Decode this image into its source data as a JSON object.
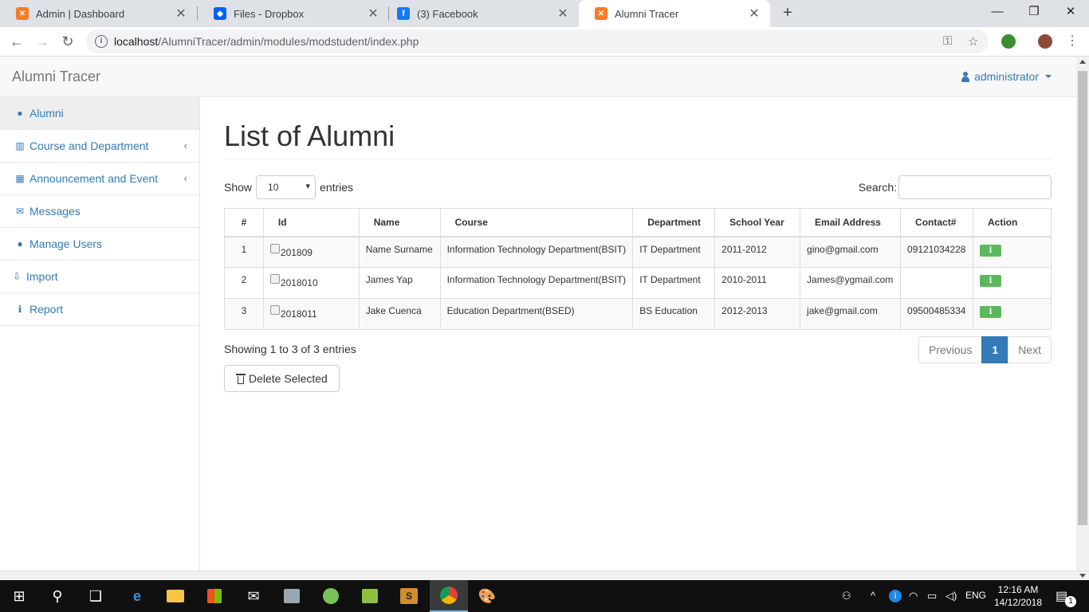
{
  "browser": {
    "tabs": [
      {
        "title": "Admin | Dashboard",
        "favicon": "xampp-icon",
        "favicon_color": "#fb7a24"
      },
      {
        "title": "Files - Dropbox",
        "favicon": "dropbox-icon",
        "favicon_color": "#0061fe"
      },
      {
        "title": "(3) Facebook",
        "favicon": "facebook-icon",
        "favicon_color": "#1877f2"
      },
      {
        "title": "Alumni Tracer",
        "favicon": "xampp-icon",
        "favicon_color": "#fb7a24"
      }
    ],
    "active_tab": 3,
    "close_glyph": "✕",
    "new_tab_glyph": "+",
    "url_host": "localhost",
    "url_path": "/AlumniTracer/admin/modules/modstudent/index.php"
  },
  "app": {
    "brand": "Alumni Tracer",
    "user": "administrator",
    "colors": {
      "link": "#337ab7",
      "success": "#5cb85c"
    },
    "sidebar": [
      {
        "label": "Alumni",
        "icon": "user-icon",
        "glyph": "👤",
        "active": true,
        "has_arrow": false
      },
      {
        "label": "Course and Department",
        "icon": "building-icon",
        "glyph": "▥",
        "active": false,
        "has_arrow": true
      },
      {
        "label": "Announcement and Event",
        "icon": "calendar-icon",
        "glyph": "▦",
        "active": false,
        "has_arrow": true
      },
      {
        "label": "Messages",
        "icon": "envelope-icon",
        "glyph": "✉",
        "active": false,
        "has_arrow": false
      },
      {
        "label": "Manage Users",
        "icon": "user-icon",
        "glyph": "👤",
        "active": false,
        "has_arrow": false
      },
      {
        "label": "Import",
        "icon": "import-icon",
        "glyph": "⇩",
        "active": false,
        "has_arrow": false
      },
      {
        "label": "Report",
        "icon": "info-icon",
        "glyph": "ℹ",
        "active": false,
        "has_arrow": false
      }
    ],
    "page_title": "List of Alumni",
    "length": {
      "show": "Show",
      "value": "10",
      "entries": "entries"
    },
    "search_label": "Search:",
    "columns": [
      "#",
      "Id",
      "Name",
      "Course",
      "Department",
      "School Year",
      "Email Address",
      "Contact#",
      "Action"
    ],
    "rows": [
      {
        "num": "1",
        "id": "201809",
        "name": "Name Surname",
        "course": "Information Technology Department(BSIT)",
        "department": "IT Department",
        "school_year": "2011-2012",
        "email": "gino@gmail.com",
        "contact": "09121034228",
        "action": "i"
      },
      {
        "num": "2",
        "id": "2018010",
        "name": "James Yap",
        "course": "Information Technology Department(BSIT)",
        "department": "IT Department",
        "school_year": "2010-2011",
        "email": "James@ygmail.com",
        "contact": "",
        "action": "i"
      },
      {
        "num": "3",
        "id": "2018011",
        "name": "Jake Cuenca",
        "course": "Education Department(BSED)",
        "department": "BS Education",
        "school_year": "2012-2013",
        "email": "jake@gmail.com",
        "contact": "09500485334",
        "action": "i"
      }
    ],
    "info": "Showing 1 to 3 of 3 entries",
    "pagination": {
      "previous": "Previous",
      "current": "1",
      "next": "Next"
    },
    "delete_button": "Delete Selected"
  },
  "taskbar": {
    "apps": [
      "windows-start-icon",
      "search-icon",
      "task-view-icon",
      "edge-icon",
      "file-explorer-icon",
      "store-icon",
      "mail-icon",
      "app-icon",
      "android-studio-icon",
      "app-icon",
      "sublime-text-icon",
      "chrome-icon",
      "paint-icon"
    ],
    "language": "ENG",
    "time": "12:16 AM",
    "date": "14/12/2018",
    "notifications": "1"
  }
}
